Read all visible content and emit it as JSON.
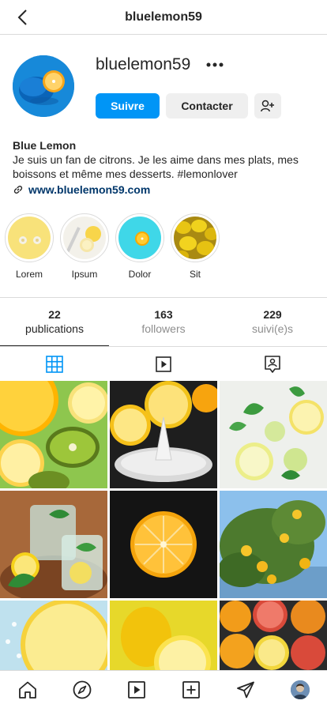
{
  "header": {
    "title": "bluelemon59",
    "back_icon": "chevron-left-icon"
  },
  "profile": {
    "username": "bluelemon59",
    "more_icon": "more-horizontal-icon",
    "follow_label": "Suivre",
    "contact_label": "Contacter",
    "add_user_icon": "add-user-icon",
    "accent_color": "#0095f6"
  },
  "bio": {
    "name": "Blue Lemon",
    "text": "Je suis un fan de citrons. Je les aime dans mes plats, mes boissons et même mes desserts. #lemonlover",
    "link": "www.bluelemon59.com",
    "link_color": "#00376b"
  },
  "highlights": [
    {
      "label": "Lorem"
    },
    {
      "label": "Ipsum"
    },
    {
      "label": "Dolor"
    },
    {
      "label": "Sit"
    }
  ],
  "stats": [
    {
      "count": "22",
      "label": "publications"
    },
    {
      "count": "163",
      "label": "followers"
    },
    {
      "count": "229",
      "label": "suivi(e)s"
    }
  ],
  "tabs": [
    {
      "icon": "grid-icon",
      "active": true
    },
    {
      "icon": "reels-icon",
      "active": false
    },
    {
      "icon": "tagged-icon",
      "active": false
    }
  ],
  "bottom_nav": [
    "home-icon",
    "explore-icon",
    "reels-icon",
    "new-post-icon",
    "direct-message-icon",
    "profile-avatar"
  ]
}
